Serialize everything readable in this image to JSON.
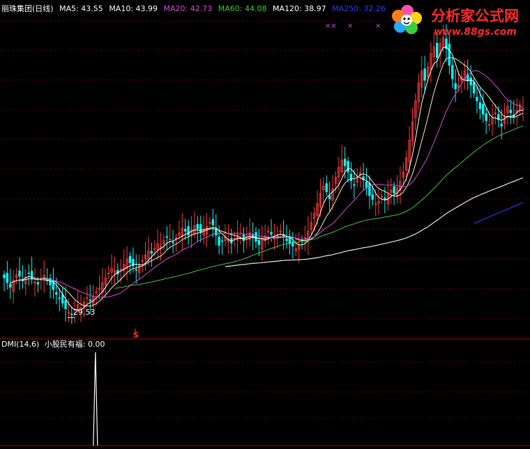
{
  "header": {
    "stock_title": "丽珠集团(日线)",
    "ma": [
      {
        "label": "MA5: 43.55",
        "color": "#ffffff"
      },
      {
        "label": "MA10: 43.99",
        "color": "#ffffff"
      },
      {
        "label": "MA20: 42.73",
        "color": "#d84bd8"
      },
      {
        "label": "MA60: 44.08",
        "color": "#3ccc3c"
      },
      {
        "label": "MA120: 38.97",
        "color": "#ffffff"
      },
      {
        "label": "MA250: 32.26",
        "color": "#2a3cff"
      }
    ]
  },
  "indicator": {
    "label": "DMI(14,6)",
    "line_label": "小股民有福: 0.00"
  },
  "annotations": {
    "low_price": "29.53",
    "signal": "S",
    "markers": [
      "××",
      "×",
      "×"
    ]
  },
  "watermark": {
    "site": "分析家公式网",
    "url": "www.88gs.com"
  },
  "colors": {
    "up": "#ff3c3c",
    "down": "#00ffff",
    "grid": "#7a0000",
    "ma20": "#d84bd8",
    "ma60": "#3ccc3c",
    "ma120": "#e8e8e8",
    "ma250": "#2a3cff"
  },
  "chart_data": {
    "type": "candlestick",
    "title": "丽珠集团(日线)",
    "price_series": [
      34.2,
      33.6,
      33.0,
      33.9,
      34.6,
      34.4,
      33.8,
      34.3,
      34.8,
      34.1,
      33.7,
      33.4,
      34.0,
      34.5,
      33.9,
      33.3,
      32.7,
      32.1,
      31.6,
      31.0,
      30.3,
      29.8,
      29.53,
      30.2,
      30.8,
      30.4,
      31.1,
      31.7,
      31.3,
      31.9,
      32.4,
      32.9,
      33.6,
      34.2,
      34.8,
      35.4,
      35.1,
      34.7,
      35.3,
      35.9,
      36.6,
      36.1,
      35.7,
      35.2,
      35.8,
      36.4,
      37.1,
      37.6,
      37.3,
      37.9,
      38.5,
      38.2,
      38.9,
      39.4,
      39.1,
      38.6,
      39.3,
      39.9,
      40.5,
      40.1,
      39.6,
      40.3,
      40.8,
      40.4,
      39.9,
      40.2,
      40.7,
      41.2,
      40.9,
      39.6,
      38.3,
      38.8,
      39.4,
      39.1,
      38.6,
      39.2,
      39.7,
      39.3,
      38.9,
      39.5,
      39.9,
      39.4,
      38.8,
      38.4,
      38.9,
      39.5,
      40.1,
      39.7,
      39.2,
      39.6,
      40.1,
      39.5,
      38.9,
      38.5,
      38.2,
      37.9,
      38.4,
      38.9,
      39.3,
      40.1,
      41.2,
      42.4,
      43.6,
      44.9,
      45.8,
      45.1,
      44.2,
      45.5,
      46.9,
      48.2,
      49.1,
      48.4,
      47.6,
      46.5,
      45.9,
      46.8,
      47.5,
      46.6,
      45.6,
      44.6,
      44.1,
      43.6,
      43.9,
      44.5,
      44.1,
      44.7,
      45.3,
      44.9,
      45.6,
      46.4,
      47.6,
      49.4,
      51.6,
      53.9,
      56.6,
      58.9,
      60.4,
      59.2,
      60.9,
      62.6,
      63.4,
      62.1,
      63.9,
      64.6,
      63.2,
      61.1,
      59.4,
      58.1,
      58.6,
      59.6,
      60.4,
      59.1,
      58.6,
      57.6,
      56.6,
      55.6,
      54.9,
      54.1,
      53.6,
      54.4,
      55.1,
      54.2,
      53.4,
      54.6,
      55.9,
      55.1,
      54.6,
      55.4,
      56.1,
      55.6
    ],
    "moving_averages": [
      "MA5",
      "MA10",
      "MA20",
      "MA60",
      "MA120",
      "MA250"
    ],
    "ma_values": {
      "MA5": 43.55,
      "MA10": 43.99,
      "MA20": 42.73,
      "MA60": 44.08,
      "MA120": 38.97,
      "MA250": 32.26
    },
    "low_label": 29.53,
    "indicator": {
      "name": "DMI(14,6)",
      "series_name": "小股民有福",
      "value": 0.0,
      "spike_index": 22
    }
  }
}
